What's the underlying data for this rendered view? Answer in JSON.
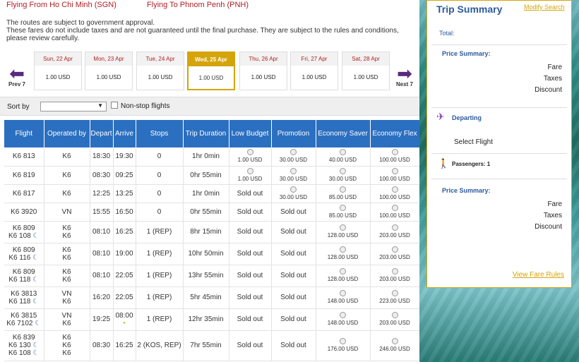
{
  "route": {
    "from": "Flying From Ho Chi Minh (SGN)",
    "to": "Flying To Phnom Penh (PNH)"
  },
  "notice": [
    "The routes are subject to government approval.",
    "These fares do not include taxes and are not guaranteed until the final purchase. They are subject to the rules and conditions,",
    "please review carefully."
  ],
  "dates": {
    "prev": "Prev 7",
    "next": "Next 7",
    "items": [
      {
        "label": "Sun, 22 Apr",
        "price": "1.00 USD"
      },
      {
        "label": "Mon, 23 Apr",
        "price": "1.00 USD"
      },
      {
        "label": "Tue, 24 Apr",
        "price": "1.00 USD"
      },
      {
        "label": "Wed, 25 Apr",
        "price": "1.00 USD",
        "active": true
      },
      {
        "label": "Thu, 26 Apr",
        "price": "1.00 USD"
      },
      {
        "label": "Fri, 27 Apr",
        "price": "1.00 USD"
      },
      {
        "label": "Sat, 28 Apr",
        "price": "1.00 USD"
      }
    ]
  },
  "sort": {
    "label": "Sort by",
    "value": "",
    "nonstop": "Non-stop flights"
  },
  "table": {
    "headers": [
      "Flight",
      "Operated by",
      "Depart",
      "Arrive",
      "Stops",
      "Trip Duration",
      "Low Budget",
      "Promotion",
      "Economy Saver",
      "Economy Flex"
    ],
    "rows": [
      {
        "flight": [
          "K6 813"
        ],
        "op": [
          "K6"
        ],
        "dep": "18:30",
        "arr": "19:30",
        "stops": "0",
        "dur": "1hr 0min",
        "fares": [
          "1.00 USD",
          "30.00 USD",
          "40.00 USD",
          "100.00 USD"
        ]
      },
      {
        "flight": [
          "K6 819"
        ],
        "op": [
          "K6"
        ],
        "dep": "08:30",
        "arr": "09:25",
        "stops": "0",
        "dur": "0hr 55min",
        "fares": [
          "1.00 USD",
          "30.00 USD",
          "30.00 USD",
          "100.00 USD"
        ]
      },
      {
        "flight": [
          "K6 817"
        ],
        "op": [
          "K6"
        ],
        "dep": "12:25",
        "arr": "13:25",
        "stops": "0",
        "dur": "1hr 0min",
        "fares": [
          "Sold out",
          "30.00 USD",
          "85.00 USD",
          "100.00 USD"
        ]
      },
      {
        "flight": [
          "K6 3920"
        ],
        "op": [
          "VN"
        ],
        "dep": "15:55",
        "arr": "16:50",
        "stops": "0",
        "dur": "0hr 55min",
        "fares": [
          "Sold out",
          "Sold out",
          "85.00 USD",
          "100.00 USD"
        ]
      },
      {
        "flight": [
          "K6 809",
          "K6 108"
        ],
        "op": [
          "K6",
          "K6"
        ],
        "dep": "08:10",
        "arr": "16:25",
        "stops": "1 (REP)",
        "dur": "8hr 15min",
        "fares": [
          "Sold out",
          "Sold out",
          "128.00 USD",
          "203.00 USD"
        ]
      },
      {
        "flight": [
          "K6 809",
          "K6 116"
        ],
        "op": [
          "K6",
          "K6"
        ],
        "dep": "08:10",
        "arr": "19:00",
        "stops": "1 (REP)",
        "dur": "10hr 50min",
        "fares": [
          "Sold out",
          "Sold out",
          "128.00 USD",
          "203.00 USD"
        ]
      },
      {
        "flight": [
          "K6 809",
          "K6 118"
        ],
        "op": [
          "K6",
          "K6"
        ],
        "dep": "08:10",
        "arr": "22:05",
        "stops": "1 (REP)",
        "dur": "13hr 55min",
        "fares": [
          "Sold out",
          "Sold out",
          "128.00 USD",
          "203.00 USD"
        ]
      },
      {
        "flight": [
          "K6 3813",
          "K6 118"
        ],
        "op": [
          "VN",
          "K6"
        ],
        "dep": "16:20",
        "arr": "22:05",
        "stops": "1 (REP)",
        "dur": "5hr 45min",
        "fares": [
          "Sold out",
          "Sold out",
          "148.00 USD",
          "223.00 USD"
        ]
      },
      {
        "flight": [
          "K6 3815",
          "K6 7102"
        ],
        "op": [
          "VN",
          "K6"
        ],
        "dep": "19:25",
        "arr": "08:00",
        "stops": "1 (REP)",
        "dur": "12hr 35min",
        "fares": [
          "Sold out",
          "Sold out",
          "148.00 USD",
          "203.00 USD"
        ]
      },
      {
        "flight": [
          "K6 839",
          "K6 130",
          "K6 108"
        ],
        "op": [
          "K6",
          "K6",
          "K6"
        ],
        "dep": "08:30",
        "arr": "16:25",
        "stops": "2 (KOS, REP)",
        "dur": "7hr 55min",
        "fares": [
          "Sold out",
          "Sold out",
          "176.00 USD",
          "246.00 USD"
        ]
      }
    ]
  },
  "summary": {
    "title": "Trip Summary",
    "modify": "Modify Search",
    "total": "Total:",
    "price_summary": "Price Summary:",
    "fare": "Fare",
    "taxes": "Taxes",
    "discount": "Discount",
    "departing": "Departing",
    "select_flight": "Select Flight",
    "passengers": "Passengers: 1",
    "rules": "View Fare Rules"
  }
}
